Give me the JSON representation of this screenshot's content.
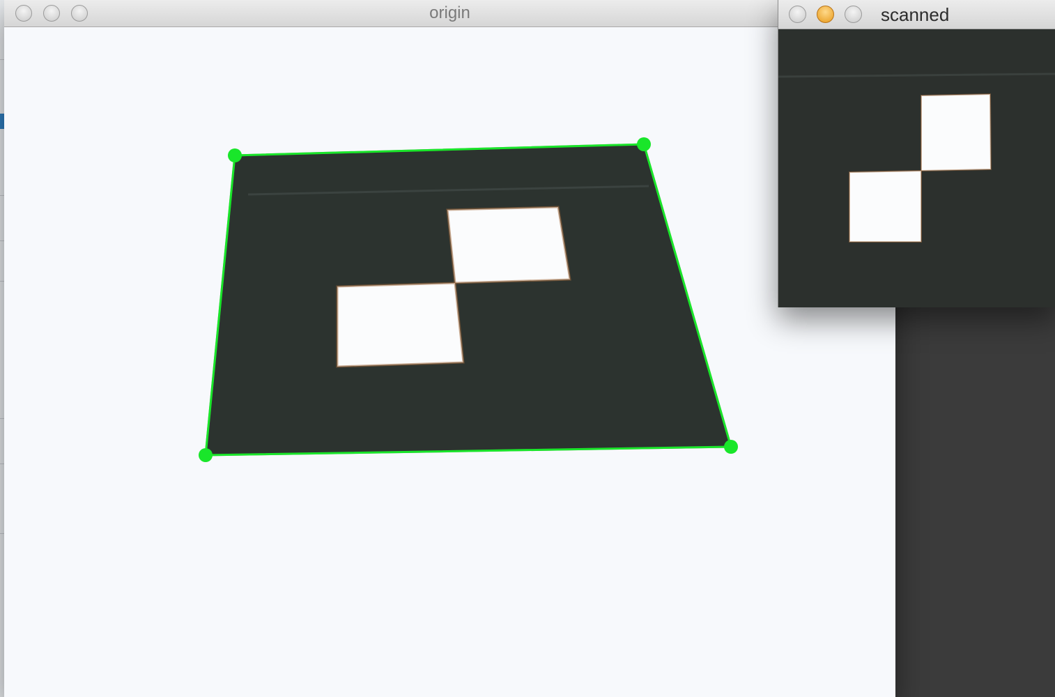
{
  "windows": {
    "origin": {
      "title": "origin"
    },
    "scanned": {
      "title": "scanned"
    }
  },
  "colors": {
    "background_paper": "#f7f9fc",
    "marker_dark": "#2c332f",
    "contour_green": "#19e62a",
    "traffic_light_active": "#e79a1b",
    "desktop": "#3b3b3b"
  },
  "icons": {
    "close": "close-button-icon",
    "minimize": "minimize-button-icon",
    "zoom": "zoom-button-icon"
  }
}
